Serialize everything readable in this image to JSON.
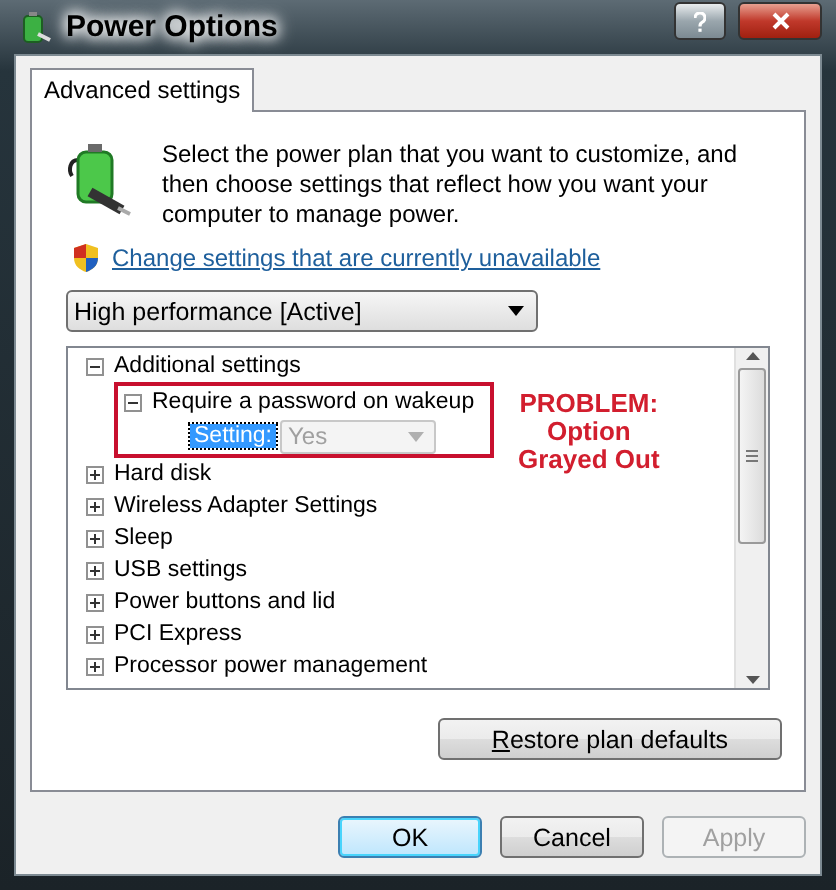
{
  "window": {
    "title": "Power Options"
  },
  "tabs": [
    {
      "label": "Advanced settings",
      "selected": true
    }
  ],
  "intro": "Select the power plan that you want to customize, and then choose settings that reflect how you want your computer to manage power.",
  "link": "Change settings that are currently unavailable",
  "plan_dropdown": {
    "value": "High performance [Active]"
  },
  "tree": [
    {
      "label": "Additional settings",
      "expanded": true,
      "children": [
        {
          "label": "Require a password on wakeup",
          "expanded": true,
          "outlined": true,
          "setting": {
            "label": "Setting:",
            "selected": true,
            "value": "Yes",
            "disabled": true
          }
        }
      ]
    },
    {
      "label": "Hard disk",
      "expanded": false
    },
    {
      "label": "Wireless Adapter Settings",
      "expanded": false
    },
    {
      "label": "Sleep",
      "expanded": false
    },
    {
      "label": "USB settings",
      "expanded": false
    },
    {
      "label": "Power buttons and lid",
      "expanded": false
    },
    {
      "label": "PCI Express",
      "expanded": false
    },
    {
      "label": "Processor power management",
      "expanded": false
    }
  ],
  "annotation": [
    "PROBLEM:",
    "Option",
    "Grayed Out"
  ],
  "restore_button": {
    "label": "Restore plan defaults"
  },
  "buttons": [
    {
      "label": "OK",
      "default": true,
      "disabled": false
    },
    {
      "label": "Cancel",
      "default": false,
      "disabled": false
    },
    {
      "label": "Apply",
      "default": false,
      "disabled": true
    }
  ]
}
